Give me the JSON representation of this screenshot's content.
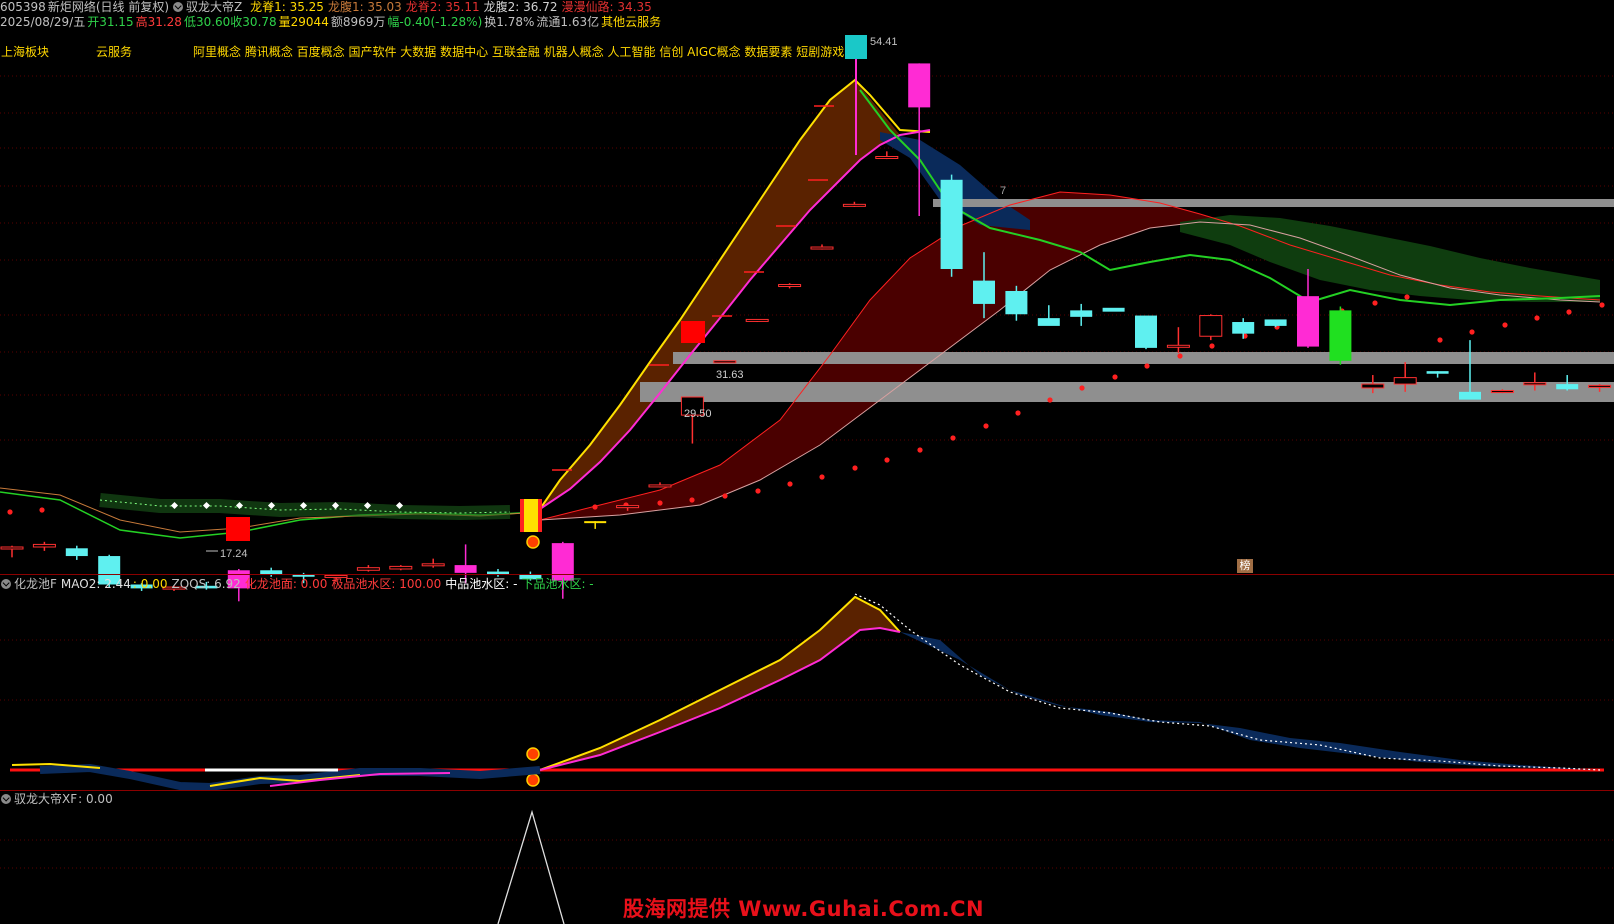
{
  "header": {
    "code": "605398",
    "name": "新炬网络",
    "period": "(日线 前复权)",
    "indicator": "驭龙大帝Z",
    "lines": [
      {
        "label": "龙脊1: 35.25",
        "color": "#ffd800"
      },
      {
        "label": "龙腹1: 35.03",
        "color": "#c77a3a"
      },
      {
        "label": "龙脊2: 35.11",
        "color": "#e23030"
      },
      {
        "label": "龙腹2: 36.72",
        "color": "#d0d0d0"
      },
      {
        "label": "漫漫仙路: 34.35",
        "color": "#e23030"
      }
    ]
  },
  "quote": {
    "date": "2025/08/29/五",
    "open": "开31.15",
    "high": "高31.28",
    "low": "低30.60",
    "close": "收30.78",
    "volume": "量29044",
    "amount": "额8969万",
    "change": "幅-0.40(-1.28%)",
    "turnover": "换1.78%",
    "float": "流通1.63亿",
    "extra": "其他云服务"
  },
  "concepts": {
    "sector": "上海板块",
    "industry": "云服务",
    "tags": "阿里概念 腾讯概念 百度概念 国产软件 大数据 数据中心 互联金融 机器人概念 人工智能 信创 AIGC概念 数据要素 短剧游戏"
  },
  "panel2": {
    "name": "化龙池F",
    "mao2": "MAO2: 2.44",
    "v2": ": 0.00",
    "zqqs": "ZQQS: 6.92",
    "ground": "化龙池面: 0.00",
    "top": "极品池水区: 100.00",
    "mid": "中品池水区: -",
    "low": "下品池水区: -"
  },
  "panel3": {
    "name": "驭龙大帝XF",
    "value": ": 0.00"
  },
  "watermark": "股海网提供 Www.Guhai.Com.CN",
  "badge": "榜",
  "chart_data": {
    "type": "candlestick",
    "price_labels": {
      "high": "54.41",
      "low": "17.24",
      "res1": "31.63",
      "res2": "29.50",
      "mark7": "7"
    },
    "candles": [
      [
        16.9,
        17.1,
        16.2,
        17.0
      ],
      [
        17.0,
        17.4,
        16.7,
        17.2
      ],
      [
        16.9,
        17.1,
        16.0,
        16.3
      ],
      [
        16.3,
        16.4,
        13.9,
        14.1
      ],
      [
        14.1,
        14.2,
        13.6,
        13.8
      ],
      [
        13.8,
        14.0,
        13.6,
        13.9
      ],
      [
        14.0,
        14.3,
        13.7,
        13.8
      ],
      [
        13.8,
        15.3,
        12.8,
        15.2
      ],
      [
        15.2,
        15.4,
        14.7,
        14.9
      ],
      [
        14.9,
        15.0,
        14.2,
        14.7
      ],
      [
        14.7,
        14.9,
        14.3,
        14.8
      ],
      [
        15.2,
        15.6,
        15.1,
        15.4
      ],
      [
        15.3,
        15.6,
        15.2,
        15.5
      ],
      [
        15.6,
        16.1,
        15.4,
        15.7
      ],
      [
        15.6,
        17.2,
        14.2,
        15.0
      ],
      [
        15.1,
        15.3,
        14.7,
        14.9
      ],
      [
        14.9,
        15.1,
        14.4,
        14.5
      ],
      [
        14.4,
        17.4,
        13.0,
        17.3
      ],
      [
        19.0,
        19.0,
        18.4,
        19.0
      ],
      [
        20.2,
        20.3,
        19.8,
        20.2
      ],
      [
        21.8,
        22.0,
        21.6,
        21.8
      ],
      [
        27.2,
        28.6,
        25.0,
        28.6
      ],
      [
        31.4,
        31.4,
        31.3,
        31.4
      ],
      [
        34.6,
        34.6,
        34.4,
        34.6
      ],
      [
        37.2,
        37.4,
        37.0,
        37.3
      ],
      [
        40.2,
        40.4,
        40.0,
        40.2
      ],
      [
        43.4,
        43.7,
        43.3,
        43.5
      ],
      [
        47.2,
        47.6,
        47.0,
        47.2
      ],
      [
        51.0,
        54.4,
        42.6,
        54.4
      ],
      [
        45.4,
        45.8,
        37.9,
        38.5
      ],
      [
        37.6,
        39.8,
        34.7,
        35.8
      ],
      [
        36.8,
        37.2,
        34.5,
        35.0
      ],
      [
        34.7,
        35.7,
        34.2,
        34.1
      ],
      [
        35.3,
        35.8,
        34.1,
        34.8
      ],
      [
        35.5,
        34.6,
        34.6,
        35.2
      ],
      [
        34.9,
        34.0,
        32.3,
        32.4
      ],
      [
        32.5,
        34.0,
        32.0,
        32.6
      ],
      [
        33.3,
        35.0,
        33.0,
        34.9
      ],
      [
        34.4,
        34.7,
        33.1,
        33.5
      ],
      [
        34.6,
        34.4,
        34.0,
        34.1
      ],
      [
        36.4,
        38.5,
        32.4,
        32.5
      ],
      [
        35.3,
        35.6,
        31.1,
        31.4
      ],
      [
        29.3,
        30.3,
        28.9,
        29.6
      ],
      [
        29.6,
        31.3,
        29.0,
        30.1
      ],
      [
        30.6,
        30.6,
        30.1,
        30.4
      ],
      [
        29.0,
        33.0,
        28.8,
        28.4
      ],
      [
        29.1,
        29.2,
        28.9,
        29.1
      ],
      [
        29.6,
        30.5,
        29.1,
        29.7
      ],
      [
        29.6,
        30.3,
        29.1,
        29.2
      ],
      [
        29.5,
        29.6,
        29.0,
        29.5
      ],
      [
        30.2,
        30.4,
        29.4,
        29.6
      ]
    ]
  }
}
